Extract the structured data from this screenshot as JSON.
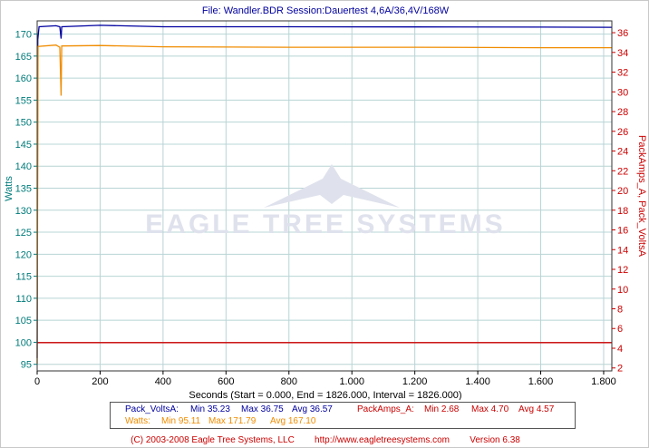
{
  "chart_data": {
    "type": "line",
    "title": "File: Wandler.BDR   Session:Dauertest 4,6A/36,4V/168W",
    "xlabel": "Seconds (Start = 0.000,  End = 1826.000,  Interval = 1826.000)",
    "ylabel_left": "Watts",
    "ylabel_right": "PackAmps_A, Pack_VoltsA",
    "xlim": [
      0,
      1826
    ],
    "ylim_left": [
      93.5,
      173
    ],
    "ylim_right": [
      1.7,
      37.2
    ],
    "grid": true,
    "x_ticks": [
      {
        "value": 0,
        "label": "0"
      },
      {
        "value": 200,
        "label": "200"
      },
      {
        "value": 400,
        "label": "400"
      },
      {
        "value": 600,
        "label": "600"
      },
      {
        "value": 800,
        "label": "800"
      },
      {
        "value": 1000,
        "label": "1.000"
      },
      {
        "value": 1200,
        "label": "1.200"
      },
      {
        "value": 1400,
        "label": "1.400"
      },
      {
        "value": 1600,
        "label": "1.600"
      },
      {
        "value": 1800,
        "label": "1.800"
      }
    ],
    "y_ticks_left": [
      95,
      100,
      105,
      110,
      115,
      120,
      125,
      130,
      135,
      140,
      145,
      150,
      155,
      160,
      165,
      170
    ],
    "y_ticks_right": [
      2,
      4,
      6,
      8,
      10,
      12,
      14,
      16,
      18,
      20,
      22,
      24,
      26,
      28,
      30,
      32,
      34,
      36
    ],
    "series": [
      {
        "name": "Pack_VoltsA",
        "axis": "right",
        "color": "#0000a0",
        "points": [
          [
            0,
            3.0
          ],
          [
            2,
            35.3
          ],
          [
            6,
            36.6
          ],
          [
            60,
            36.7
          ],
          [
            72,
            36.6
          ],
          [
            76,
            35.4
          ],
          [
            78,
            36.6
          ],
          [
            200,
            36.75
          ],
          [
            400,
            36.6
          ],
          [
            800,
            36.6
          ],
          [
            1200,
            36.58
          ],
          [
            1600,
            36.57
          ],
          [
            1826,
            36.55
          ]
        ]
      },
      {
        "name": "Watts",
        "axis": "left",
        "color": "#f08c00",
        "points": [
          [
            0,
            95.1
          ],
          [
            3,
            167.2
          ],
          [
            60,
            167.5
          ],
          [
            72,
            167.0
          ],
          [
            76,
            156.0
          ],
          [
            78,
            167.3
          ],
          [
            200,
            167.4
          ],
          [
            400,
            167.1
          ],
          [
            800,
            167.0
          ],
          [
            1200,
            167.0
          ],
          [
            1600,
            166.9
          ],
          [
            1826,
            166.9
          ]
        ]
      },
      {
        "name": "PackAmps_A",
        "axis": "right",
        "color": "#cc0000",
        "points": [
          [
            0,
            4.57
          ],
          [
            1826,
            4.57
          ]
        ]
      }
    ],
    "stats": {
      "volts": {
        "name": "Pack_VoltsA:",
        "min": "Min 35.23",
        "max": "Max 36.75",
        "avg": "Avg 36.57"
      },
      "amps": {
        "name": "PackAmps_A:",
        "min": "Min 2.68",
        "max": "Max 4.70",
        "avg": "Avg 4.57"
      },
      "watts": {
        "name": "Watts:",
        "min": "Min 95.11",
        "max": "Max 171.79",
        "avg": "Avg 167.10"
      }
    },
    "watermark": "EAGLE TREE SYSTEMS"
  },
  "footer": {
    "copyright": "(C) 2003-2008 Eagle Tree Systems, LLC",
    "url": "http://www.eagletreesystems.com",
    "version": "Version 6.38"
  },
  "colors": {
    "volts": "#0000a0",
    "watts": "#f08c00",
    "amps": "#cc0000",
    "left_axis": "#007a7a",
    "right_axis": "#cc0000",
    "grid": "#b8d4d4",
    "title": "#0000a0"
  }
}
